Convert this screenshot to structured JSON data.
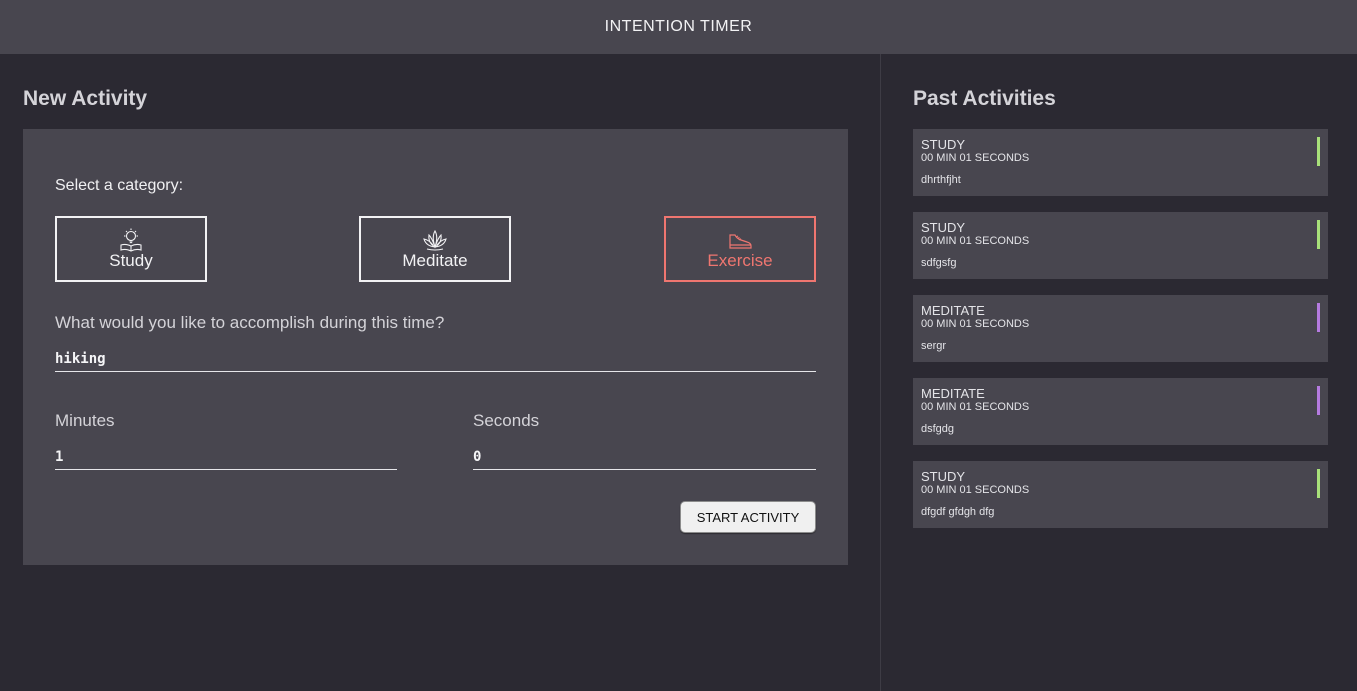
{
  "header": {
    "title": "INTENTION TIMER"
  },
  "new_activity": {
    "title": "New Activity",
    "category_prompt": "Select a category:",
    "categories": [
      {
        "label": "Study",
        "icon": "lightbulb-book-icon",
        "selected": false
      },
      {
        "label": "Meditate",
        "icon": "lotus-icon",
        "selected": false
      },
      {
        "label": "Exercise",
        "icon": "sneaker-icon",
        "selected": true
      }
    ],
    "question": "What would you like to accomplish during this time?",
    "intention_value": "hiking",
    "minutes_label": "Minutes",
    "minutes_value": "1",
    "seconds_label": "Seconds",
    "seconds_value": "0",
    "start_label": "START ACTIVITY"
  },
  "past": {
    "title": "Past Activities",
    "items": [
      {
        "category": "STUDY",
        "duration": "00 MIN 01 SECONDS",
        "description": "dhrthfjht",
        "color": "#a8e07a"
      },
      {
        "category": "STUDY",
        "duration": "00 MIN 01 SECONDS",
        "description": "sdfgsfg",
        "color": "#a8e07a"
      },
      {
        "category": "MEDITATE",
        "duration": "00 MIN 01 SECONDS",
        "description": "sergr",
        "color": "#b57be0"
      },
      {
        "category": "MEDITATE",
        "duration": "00 MIN 01 SECONDS",
        "description": "dsfgdg",
        "color": "#b57be0"
      },
      {
        "category": "STUDY",
        "duration": "00 MIN 01 SECONDS",
        "description": "dfgdf gfdgh dfg",
        "color": "#a8e07a"
      }
    ]
  },
  "colors": {
    "header_bg": "#48464f",
    "page_bg": "#2b2932",
    "panel_bg": "#48464f",
    "exercise_accent": "#ef7670",
    "study_accent": "#a8e07a",
    "meditate_accent": "#b57be0"
  }
}
